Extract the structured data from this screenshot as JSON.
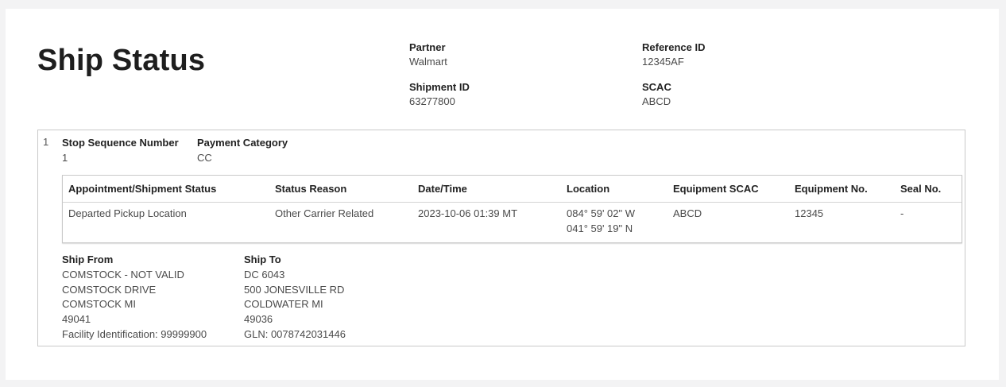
{
  "title": "Ship Status",
  "meta": {
    "partner": {
      "label": "Partner",
      "value": "Walmart"
    },
    "reference_id": {
      "label": "Reference ID",
      "value": "12345AF"
    },
    "shipment_id": {
      "label": "Shipment ID",
      "value": "63277800"
    },
    "scac": {
      "label": "SCAC",
      "value": "ABCD"
    }
  },
  "stop": {
    "index": "1",
    "stop_sequence": {
      "label": "Stop Sequence Number",
      "value": "1"
    },
    "payment_category": {
      "label": "Payment Category",
      "value": "CC"
    },
    "table": {
      "headers": [
        "Appointment/Shipment Status",
        "Status Reason",
        "Date/Time",
        "Location",
        "Equipment SCAC",
        "Equipment No.",
        "Seal No."
      ],
      "rows": [
        {
          "status": "Departed Pickup Location",
          "reason": "Other Carrier Related",
          "datetime": "2023-10-06 01:39 MT",
          "location_line1": "084° 59' 02\" W",
          "location_line2": "041° 59' 19\" N",
          "equipment_scac": "ABCD",
          "equipment_no": "12345",
          "seal_no": "-"
        }
      ]
    },
    "ship_from": {
      "label": "Ship From",
      "lines": [
        "COMSTOCK - NOT VALID",
        "COMSTOCK DRIVE",
        "COMSTOCK MI",
        "49041",
        "Facility Identification: 99999900"
      ]
    },
    "ship_to": {
      "label": "Ship To",
      "lines": [
        "DC 6043",
        "500 JONESVILLE RD",
        "COLDWATER MI",
        "49036",
        "GLN: 0078742031446"
      ]
    }
  }
}
